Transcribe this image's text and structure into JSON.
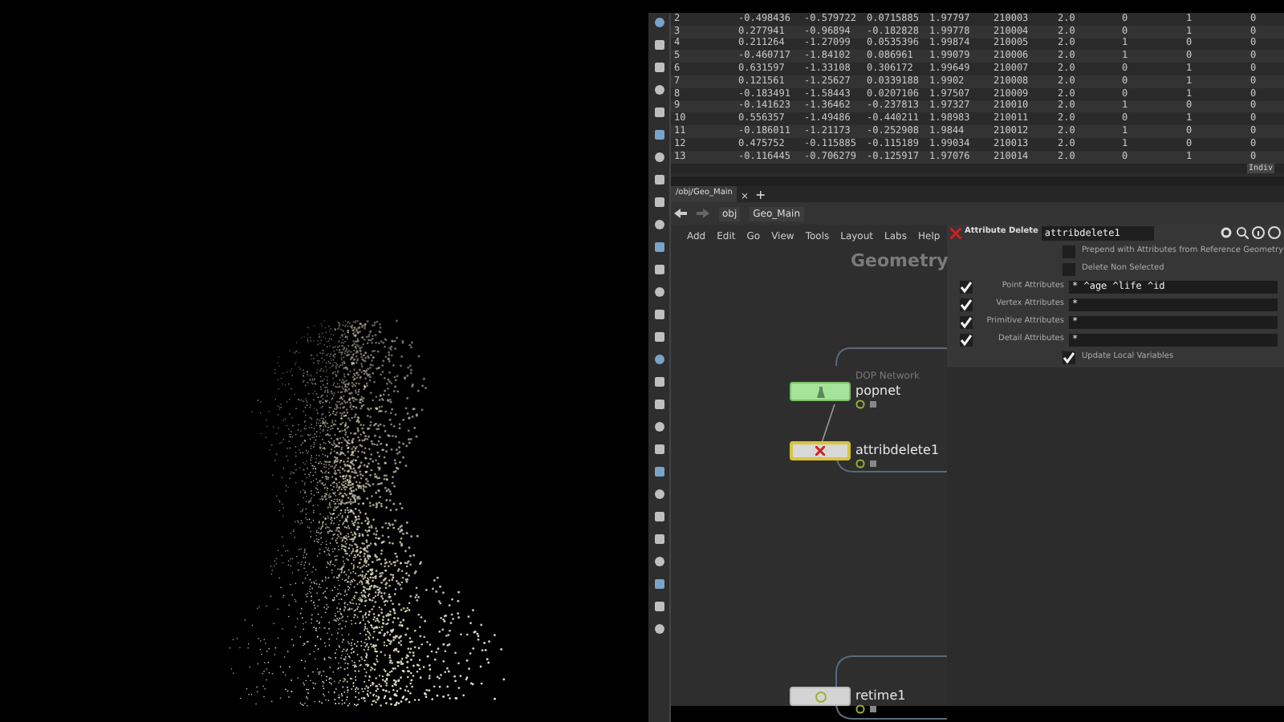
{
  "spreadsheet": {
    "rows": [
      [
        "2",
        "-0.498436",
        "-0.579722",
        "0.0715885",
        "1.97797",
        "210003",
        "2.0",
        "0",
        "1",
        "0"
      ],
      [
        "3",
        "0.277941",
        "-0.96894",
        "-0.182828",
        "1.99778",
        "210004",
        "2.0",
        "0",
        "1",
        "0"
      ],
      [
        "4",
        "0.211264",
        "-1.27099",
        "0.0535396",
        "1.99874",
        "210005",
        "2.0",
        "1",
        "0",
        "0"
      ],
      [
        "5",
        "-0.460717",
        "-1.84102",
        "0.086961",
        "1.99079",
        "210006",
        "2.0",
        "1",
        "0",
        "0"
      ],
      [
        "6",
        "0.631597",
        "-1.33108",
        "0.306172",
        "1.99649",
        "210007",
        "2.0",
        "0",
        "1",
        "0"
      ],
      [
        "7",
        "0.121561",
        "-1.25627",
        "0.0339188",
        "1.9902",
        "210008",
        "2.0",
        "0",
        "1",
        "0"
      ],
      [
        "8",
        "-0.183491",
        "-1.58443",
        "0.0207106",
        "1.97507",
        "210009",
        "2.0",
        "0",
        "1",
        "0"
      ],
      [
        "9",
        "-0.141623",
        "-1.36462",
        "-0.237813",
        "1.97327",
        "210010",
        "2.0",
        "1",
        "0",
        "0"
      ],
      [
        "10",
        "0.556357",
        "-1.49486",
        "-0.440211",
        "1.98983",
        "210011",
        "2.0",
        "0",
        "1",
        "0"
      ],
      [
        "11",
        "-0.186011",
        "-1.21173",
        "-0.252908",
        "1.9844",
        "210012",
        "2.0",
        "1",
        "0",
        "0"
      ],
      [
        "12",
        "0.475752",
        "-0.115885",
        "-0.115189",
        "1.99034",
        "210013",
        "2.0",
        "1",
        "0",
        "0"
      ],
      [
        "13",
        "-0.116445",
        "-0.706279",
        "-0.125917",
        "1.97076",
        "210014",
        "2.0",
        "0",
        "1",
        "0"
      ]
    ],
    "corner_label": "Indiv"
  },
  "network": {
    "tabs": [
      {
        "label": "/obj/Geo_Main",
        "selected": true
      }
    ],
    "close_glyph": "×",
    "add_glyph": "+",
    "path": [
      "obj",
      "Geo_Main"
    ],
    "menu": [
      "Add",
      "Edit",
      "Go",
      "View",
      "Tools",
      "Layout",
      "Labs",
      "Help"
    ],
    "context_label": "Geometry",
    "nodes": [
      {
        "name": "popnet",
        "type_label": "DOP Network",
        "kind": "dop"
      },
      {
        "name": "attribdelete1",
        "kind": "delete"
      },
      {
        "name": "retime1",
        "kind": "retime"
      }
    ]
  },
  "parameters": {
    "node_type": "Attribute Delete",
    "node_name": "attribdelete1",
    "toggles": [
      {
        "label": "Prepend with Attributes from Reference Geometry",
        "checked": false
      },
      {
        "label": "Delete Non Selected",
        "checked": false
      }
    ],
    "fields": [
      {
        "label": "Point Attributes",
        "enabled": true,
        "value": "* ^age ^life ^id"
      },
      {
        "label": "Vertex Attributes",
        "enabled": true,
        "value": "*"
      },
      {
        "label": "Primitive Attributes",
        "enabled": true,
        "value": "*"
      },
      {
        "label": "Detail Attributes",
        "enabled": true,
        "value": "*"
      }
    ],
    "update_local_variables": {
      "label": "Update Local Variables",
      "checked": true
    }
  }
}
